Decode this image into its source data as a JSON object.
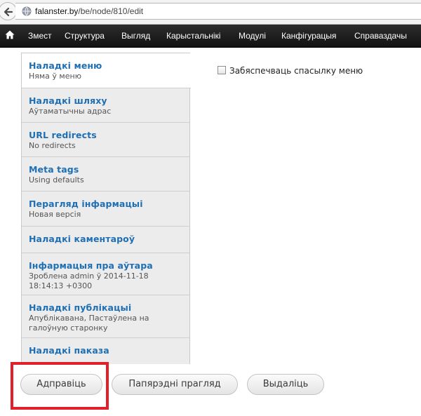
{
  "browser": {
    "url_host": "falanster.by",
    "url_path": "/be/node/810/edit"
  },
  "toolbar": {
    "items": [
      "Змест",
      "Структура",
      "Выгляд",
      "Карыстальнікі",
      "Модулі",
      "Канфігурацыя",
      "Справаздачы"
    ]
  },
  "vertical_tabs": [
    {
      "title": "Наладкі меню",
      "summary": "Няма ў меню",
      "selected": true
    },
    {
      "title": "Наладкі шляху",
      "summary": "Аўтаматычны адрас"
    },
    {
      "title": "URL redirects",
      "summary": "No redirects"
    },
    {
      "title": "Meta tags",
      "summary": "Using defaults"
    },
    {
      "title": "Перагляд інфармацыі",
      "summary": "Новая версія"
    },
    {
      "title": "Наладкі каментароў",
      "summary": ""
    },
    {
      "title": "Інфармацыя пра аўтара",
      "summary": "Зроблена admin ў 2014-11-18 18:14:13 +0300"
    },
    {
      "title": "Наладкі публікацыі",
      "summary": "Апублікавана, Пастаўлена на галоўную старонку"
    },
    {
      "title": "Наладкі паказа",
      "summary": ""
    }
  ],
  "menu_settings": {
    "provide_menu_link_label": "Забяспечваць спасылку меню",
    "checked": false
  },
  "actions": {
    "save": "Адправіць",
    "preview": "Папярэдні прагляд",
    "delete": "Выдаліць"
  },
  "colors": {
    "link": "#1f6fb4",
    "toolbar_bg": "#1a1a1a",
    "highlight": "#e0202a"
  }
}
